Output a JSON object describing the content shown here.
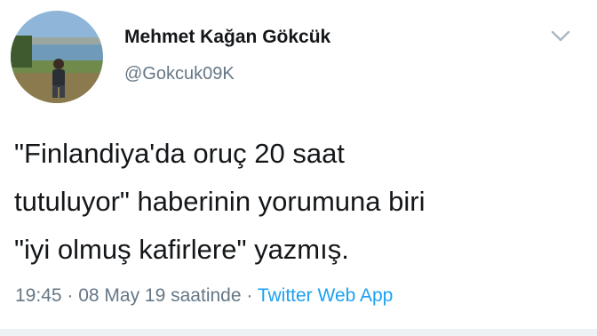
{
  "tweet": {
    "author": {
      "name": "Mehmet Kağan Gökcük",
      "handle": "@Gokcuk09K"
    },
    "text": "\"Finlandiya'da oruç 20 saat\ntutuluyor\" haberinin yorumuna biri\n\"iyi olmuş kafirlere\" yazmış.",
    "time": "19:45",
    "separator": " · ",
    "date": "08 May 19 saatinde",
    "source": "Twitter Web App"
  },
  "icons": {
    "menu": "chevron-down-icon",
    "avatar": "profile-photo"
  },
  "colors": {
    "text": "#14171a",
    "secondary": "#657786",
    "link": "#1da1f2"
  }
}
